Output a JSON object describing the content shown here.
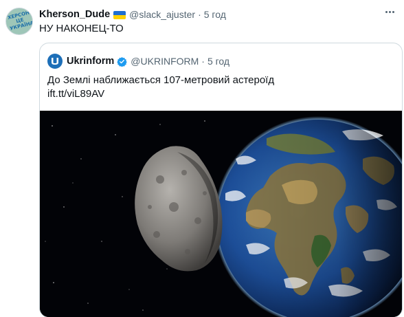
{
  "tweet": {
    "display_name": "Kherson_Dude",
    "flag_icon": "ukraine-flag-icon",
    "handle": "@slack_ajuster",
    "separator": "·",
    "time": "5 год",
    "text": "НУ НАКОНЕЦ-ТО",
    "avatar_lines": [
      "ХЕРСОН",
      "ЦЕ",
      "УКРАЇНА"
    ]
  },
  "quote": {
    "display_name": "Ukrinform",
    "verified_icon": "verified-badge-icon",
    "handle": "@UKRINFORM",
    "separator": "·",
    "time": "5 год",
    "text": "До Землі наближається 107-метровий астероїд",
    "link": "ift.tt/viL89AV",
    "image": "asteroid-approaching-earth-image"
  },
  "colors": {
    "text_primary": "#0f1419",
    "text_secondary": "#536471",
    "border": "#cfd9de",
    "verified": "#1d9bf0",
    "ukrinform_brand": "#1d6fb8"
  }
}
